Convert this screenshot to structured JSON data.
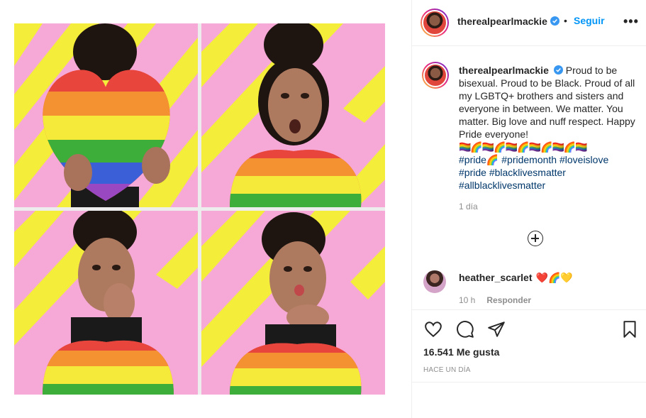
{
  "post": {
    "username": "therealpearlmackie",
    "follow_label": "Seguir",
    "separator": "•",
    "more_label": "•••",
    "caption_text": "Proud to be bisexual. Proud to be Black. Proud of all my LGBTQ+ brothers and sisters and everyone in between. We matter. You matter. Big love and nuff respect. Happy Pride everyone!",
    "flags_line": "🏳️‍🌈🌈🏳️‍🌈🌈🏳️‍🌈🌈🏳️‍🌈🌈🏳️‍🌈🌈🏳️‍🌈",
    "hashtags": [
      "#pride🌈",
      "#pridemonth",
      "#loveislove",
      "#pride",
      "#blacklivesmatter",
      "#allblacklivesmatter"
    ],
    "posted_time": "1 día",
    "likes": "16.541 Me gusta",
    "posted_ago": "HACE UN DÍA"
  },
  "comment": {
    "username": "heather_scarlet",
    "text": "❤️🌈💛",
    "time": "10 h",
    "reply_label": "Responder"
  },
  "colors": {
    "accent": "#0095f6",
    "hashtag": "#00376b",
    "muted": "#8e8e8e",
    "verified": "#3897f0"
  },
  "icons": [
    "heart-icon",
    "comment-icon",
    "share-icon",
    "bookmark-icon",
    "verified-icon",
    "add-comment-icon",
    "more-icon"
  ]
}
